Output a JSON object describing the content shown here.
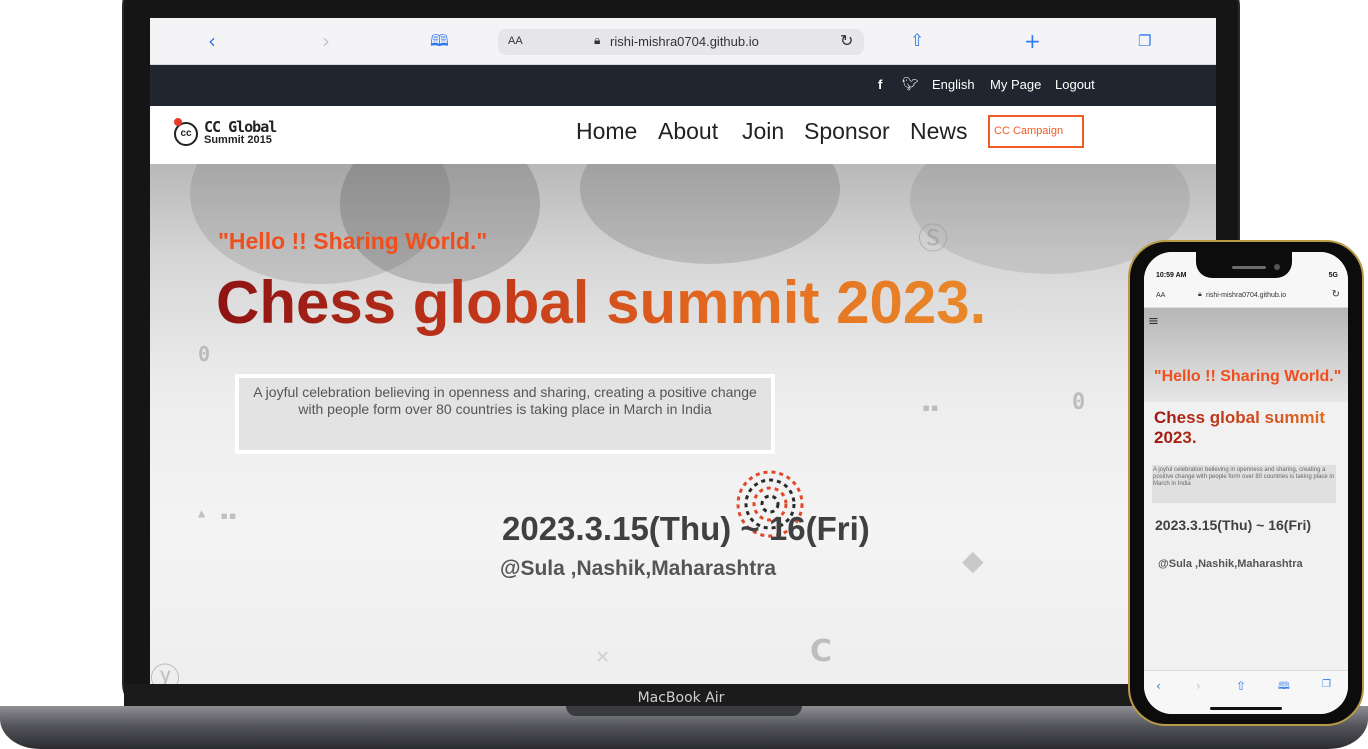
{
  "browser": {
    "back_icon": "chevron-left-icon",
    "forward_icon": "chevron-right-icon",
    "bookmarks_icon": "book-icon",
    "text_size_label": "AA",
    "url": "rishi-mishra0704.github.io",
    "reload_icon": "reload-icon",
    "share_icon": "share-icon",
    "new_tab_icon": "plus-icon",
    "tabs_icon": "tabs-icon"
  },
  "topbar": {
    "facebook": "f",
    "twitter_icon": "twitter-icon",
    "language": "English",
    "my_page": "My Page",
    "logout": "Logout"
  },
  "nav": {
    "logo": {
      "line1": "CC Global",
      "line2": "Summit 2015",
      "badge": "cc"
    },
    "links": [
      "Home",
      "About",
      "Join",
      "Sponsor",
      "News"
    ],
    "campaign_button": "CC Campaign"
  },
  "hero": {
    "tagline": "\"Hello !! Sharing World.\"",
    "title": "Chess global summit 2023.",
    "description": "A joyful celebration believing in openness and sharing, creating a positive change with people form over 80 countries is taking place in March in India",
    "date": "2023.3.15(Thu) ~ 16(Fri)",
    "location": "@Sula ,Nashik,Maharashtra"
  },
  "laptop": {
    "model_label": "MacBook Air"
  },
  "phone": {
    "time": "10:59 AM",
    "signal": "5G",
    "text_size_label": "AA",
    "url": "rishi-mishra0704.github.io",
    "menu_icon": "hamburger-icon",
    "tagline": "\"Hello !! Sharing World.\"",
    "title": "Chess global summit 2023.",
    "description": "A joyful celebration believing in openness and sharing, creating a positive change with people form over 80 countries is taking place in March in India",
    "date": "2023.3.15(Thu) ~ 16(Fri)",
    "location": "@Sula ,Nashik,Maharashtra"
  },
  "colors": {
    "accent_orange": "#f04e1c",
    "topbar_bg": "#1f2630",
    "browser_blue": "#2f7af0",
    "phone_frame": "#b99a46"
  }
}
